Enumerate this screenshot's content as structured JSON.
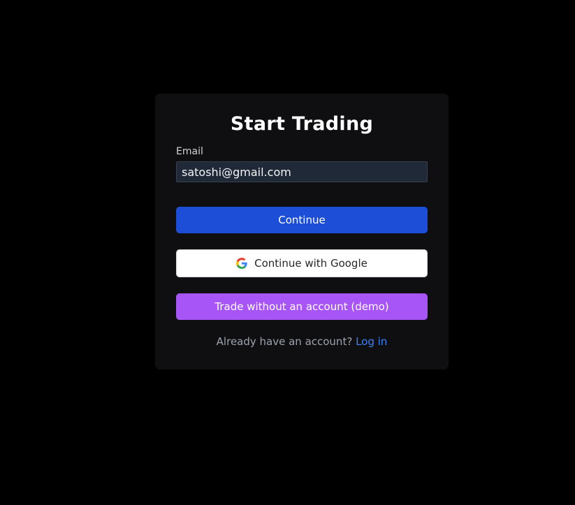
{
  "card": {
    "title": "Start Trading"
  },
  "email": {
    "label": "Email",
    "value": "satoshi@gmail.com",
    "placeholder": ""
  },
  "buttons": {
    "continue_label": "Continue",
    "google_label": "Continue with Google",
    "demo_label": "Trade without an account (demo)"
  },
  "footer": {
    "prompt": "Already have an account?",
    "login_link": "Log in"
  },
  "icons": {
    "google": "google-g-icon"
  },
  "colors": {
    "background": "#000000",
    "card": "#0f0f11",
    "primary_blue": "#1d4ed8",
    "demo_purple": "#a855f7",
    "link_blue": "#3b82f6"
  }
}
